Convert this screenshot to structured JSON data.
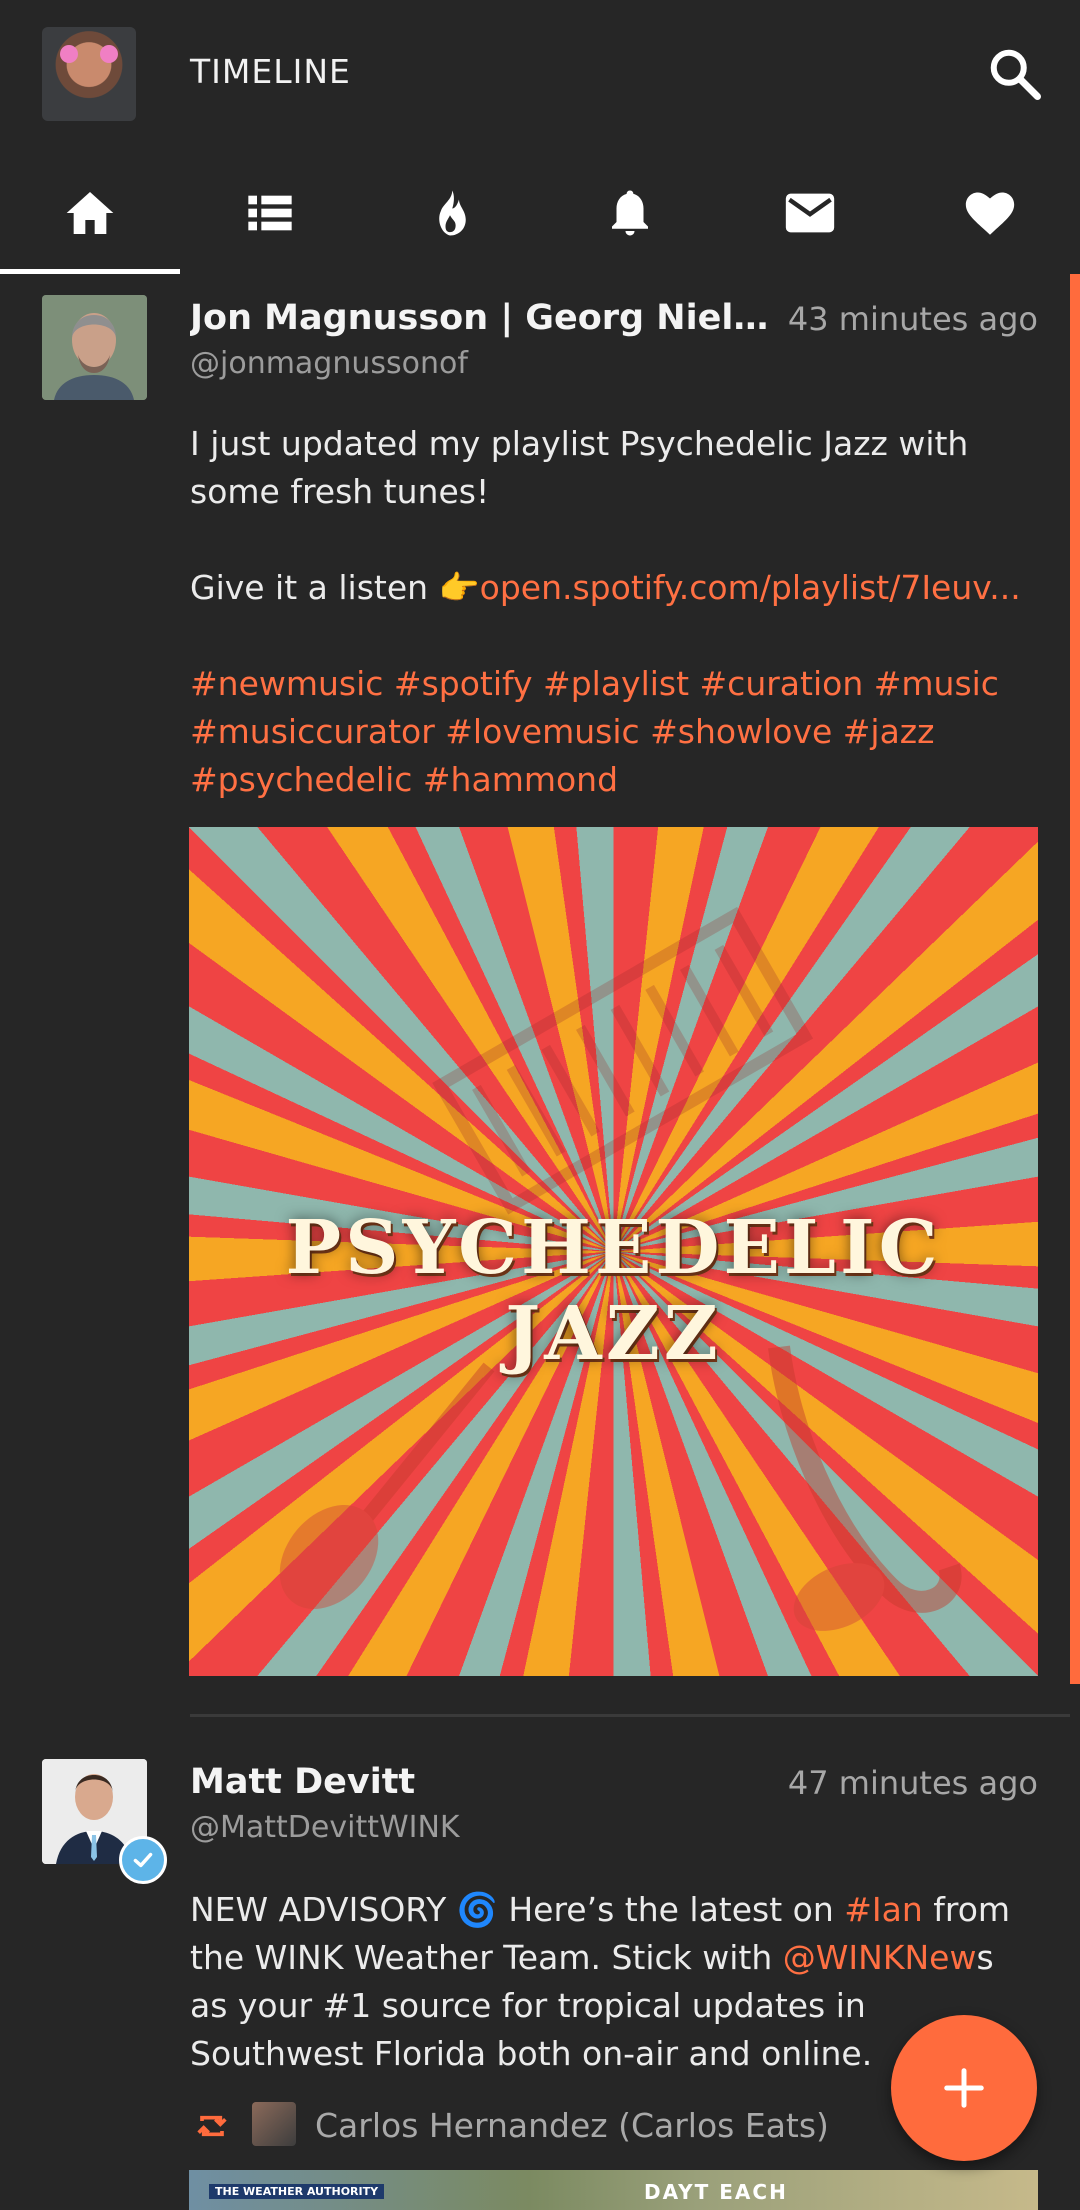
{
  "app": {
    "title": "TIMELINE",
    "accent_color": "#ff6b3d"
  },
  "tabs": [
    {
      "icon": "home-icon",
      "active": true
    },
    {
      "icon": "list-icon",
      "active": false
    },
    {
      "icon": "flame-icon",
      "active": false
    },
    {
      "icon": "bell-icon",
      "active": false
    },
    {
      "icon": "mail-icon",
      "active": false
    },
    {
      "icon": "heart-icon",
      "active": false
    }
  ],
  "posts": [
    {
      "name": "Jon Magnusson | Georg Nielsen &...",
      "handle": "@jonmagnussonof",
      "time": "43 minutes ago",
      "body_line1": "I just updated my playlist Psychedelic Jazz with some fresh tunes!",
      "body_line2_prefix": "Give it a listen 👉",
      "body_line2_link": "open.spotify.com/playlist/7Ieuv...",
      "hashtags": "#newmusic #spotify #playlist #curation #music #musiccurator #lovemusic #showlove #jazz #psychedelic #hammond",
      "media_title": "PSYCHEDELIC JAZZ"
    },
    {
      "name": "Matt Devitt",
      "handle": "@MattDevittWINK",
      "time": "47 minutes ago",
      "verified": true,
      "body_a": "NEW ADVISORY 🌀 Here’s the latest on ",
      "body_link1": "#Ian",
      "body_b": " from the WINK Weather Team. Stick with ",
      "body_link2": "@WINKNew",
      "body_c": "s as your #1 source for tropical updates in Southwest Florida both on-air and online.",
      "retweeted_by": "Carlos Hernandez (Carlos Eats)",
      "map_badge": "THE WEATHER AUTHORITY",
      "map_city": "DAYT   EACH"
    }
  ],
  "fab": {
    "label": "+"
  }
}
